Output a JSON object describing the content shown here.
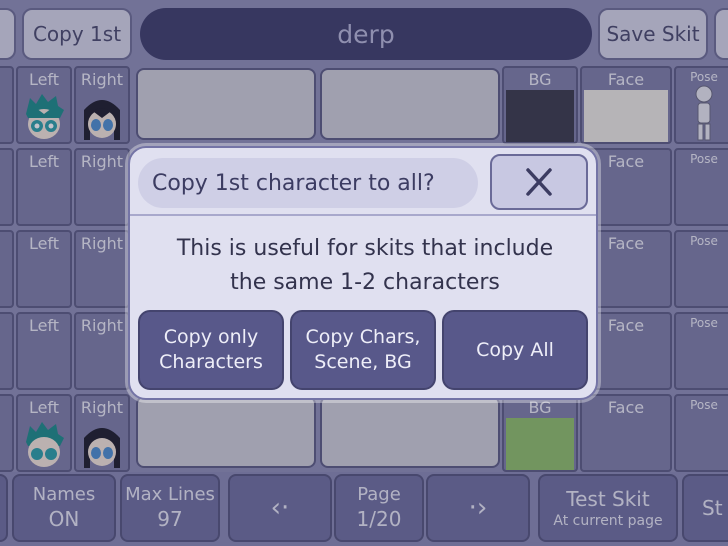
{
  "topbar": {
    "copy_first": "Copy 1st",
    "skit_title": "derp",
    "save_skit": "Save Skit"
  },
  "labels": {
    "left": "Left",
    "right": "Right",
    "bg": "BG",
    "face": "Face",
    "pose": "Pose"
  },
  "dialog": {
    "title": "Copy 1st character to all?",
    "close": "X",
    "message_line1": "This is useful for skits that include",
    "message_line2": "the same 1-2 characters",
    "btn_chars_line1": "Copy only",
    "btn_chars_line2": "Characters",
    "btn_scene_line1": "Copy Chars,",
    "btn_scene_line2": "Scene, BG",
    "btn_all": "Copy All"
  },
  "bottombar": {
    "names_label": "Names",
    "names_value": "ON",
    "maxlines_label": "Max Lines",
    "maxlines_value": "97",
    "prev_icon": "‹·",
    "page_label": "Page",
    "page_value": "1/20",
    "next_icon": "·›",
    "test_label": "Test Skit",
    "test_sub": "At current page",
    "stop_label": "St"
  },
  "colors": {
    "title_pill": "#3d3d6b",
    "dialog_bg": "#e0e0f0",
    "dialog_button": "#58588a"
  }
}
